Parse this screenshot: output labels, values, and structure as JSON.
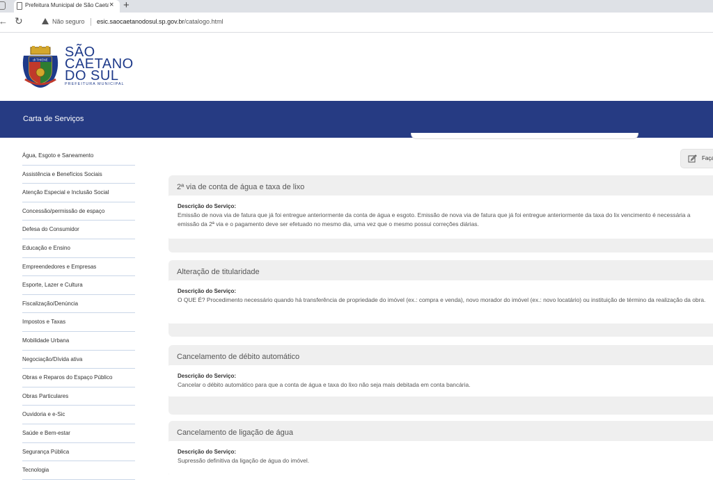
{
  "browser": {
    "tab_title": "Prefeitura Municipal de São Caeta",
    "tab_close": "×",
    "new_tab": "+",
    "back_icon": "←",
    "reload_icon": "↻",
    "security_text": "Não seguro",
    "url_domain": "esic.saocaetanodosul.sp.gov.br",
    "url_path": "/catalogo.html"
  },
  "logo": {
    "line1": "SÃO",
    "line2": "CAETANO",
    "line3": "DO SUL",
    "subtitle": "PREFEITURA MUNICIPAL",
    "crest_text": "di THIENE",
    "colors": {
      "brand_blue": "#1e3a8a",
      "crest_gold": "#d4a72c",
      "crest_red": "#c0392b",
      "crest_green": "#2e7d32"
    }
  },
  "header": {
    "title": "Carta de Serviços",
    "bar_color": "#263b83"
  },
  "sidebar": {
    "items": [
      "Água, Esgoto e Saneamento",
      "Assistência e Benefícios Sociais",
      "Atenção Especial e Inclusão Social",
      "Concessão/permissão de espaço",
      "Defesa do Consumidor",
      "Educação e Ensino",
      "Empreendedores e Empresas",
      "Esporte, Lazer e Cultura",
      "Fiscalização/Denúncia",
      "Impostos e Taxas",
      "Mobilidade Urbana",
      "Negociação/Dívida ativa",
      "Obras e Reparos do Espaço Público",
      "Obras Particulares",
      "Ouvidoria e e-Sic",
      "Saúde e Bem-estar",
      "Segurança Pública",
      "Tecnologia"
    ]
  },
  "action": {
    "label": "Faça",
    "icon": "edit-icon"
  },
  "services": [
    {
      "title": "2ª via de conta de água e taxa de lixo",
      "desc_label": "Descrição do Serviço:",
      "description": "Emissão de nova via de fatura que já foi entregue anteriormente da conta de água e esgoto. Emissão de nova via de fatura que já foi entregue anteriormente da taxa do lix vencimento é necessária a emissão da 2ª via e o pagamento deve ser efetuado no mesmo dia, uma vez que o mesmo possui correções diárias."
    },
    {
      "title": "Alteração de titularidade",
      "desc_label": "Descrição do Serviço:",
      "description": "O QUE É? Procedimento necessário quando há transferência de propriedade do imóvel (ex.: compra e venda), novo morador do imóvel (ex.: novo locatário) ou instituição de término da realização da obra."
    },
    {
      "title": "Cancelamento de débito automático",
      "desc_label": "Descrição do Serviço:",
      "description": "Cancelar o débito automático para que a conta de água e taxa do lixo não seja mais debitada em conta bancária."
    },
    {
      "title": "Cancelamento de ligação de água",
      "desc_label": "Descrição do Serviço:",
      "description": "Supressão definitiva da ligação de água do imóvel."
    }
  ]
}
